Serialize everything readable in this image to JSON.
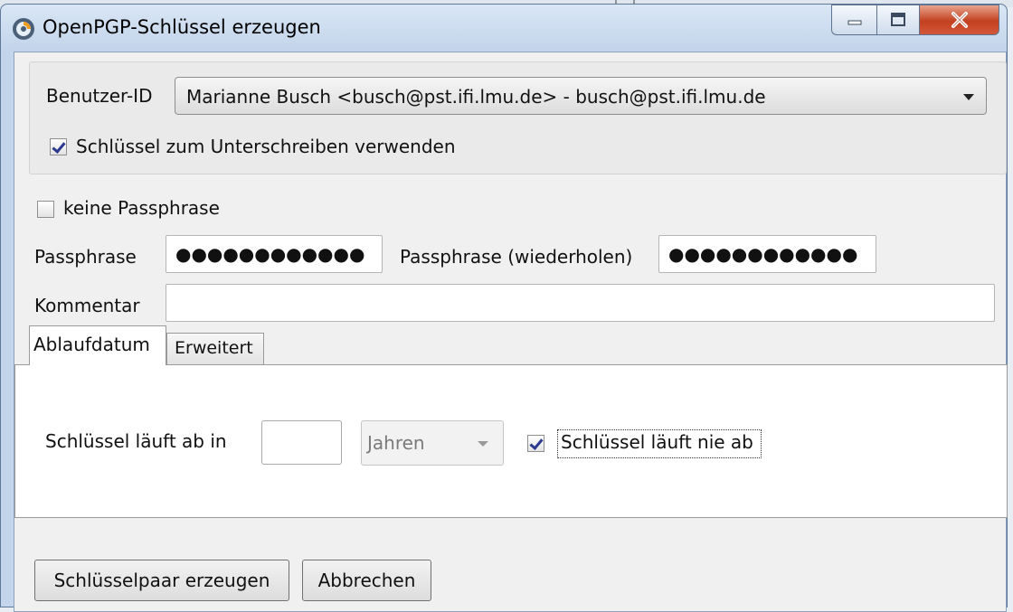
{
  "window": {
    "title": "OpenPGP-Schlüssel erzeugen"
  },
  "identity": {
    "label": "Benutzer-ID",
    "selected_value": "Marianne Busch <busch@pst.ifi.lmu.de> - busch@pst.ifi.lmu.de",
    "sign_checkbox_label": "Schlüssel zum Unterschreiben verwenden",
    "sign_checked": true
  },
  "passphrase": {
    "no_passphrase_label": "keine Passphrase",
    "no_passphrase_checked": false,
    "label": "Passphrase",
    "value_masked": "●●●●●●●●●●●●",
    "repeat_label": "Passphrase (wiederholen)",
    "repeat_value_masked": "●●●●●●●●●●●●"
  },
  "comment": {
    "label": "Kommentar",
    "value": ""
  },
  "tabs": [
    {
      "label": "Ablaufdatum",
      "active": true
    },
    {
      "label": "Erweitert",
      "active": false
    }
  ],
  "expiry": {
    "label": "Schlüssel läuft ab in",
    "value": "",
    "unit": "Jahren",
    "never_label": "Schlüssel läuft nie ab",
    "never_checked": true
  },
  "actions": {
    "generate_label": "Schlüsselpaar erzeugen",
    "cancel_label": "Abbrechen"
  },
  "icons": {
    "app": "openpgp-app-icon",
    "minimize": "minimize-icon",
    "maximize": "maximize-icon",
    "close": "close-icon",
    "dropdown": "chevron-down-icon"
  },
  "colors": {
    "titlebar": "#c2d4ea",
    "close_button": "#c2401f",
    "dialog_bg": "#f0f0f0",
    "checkmark": "#2a3a8e"
  }
}
